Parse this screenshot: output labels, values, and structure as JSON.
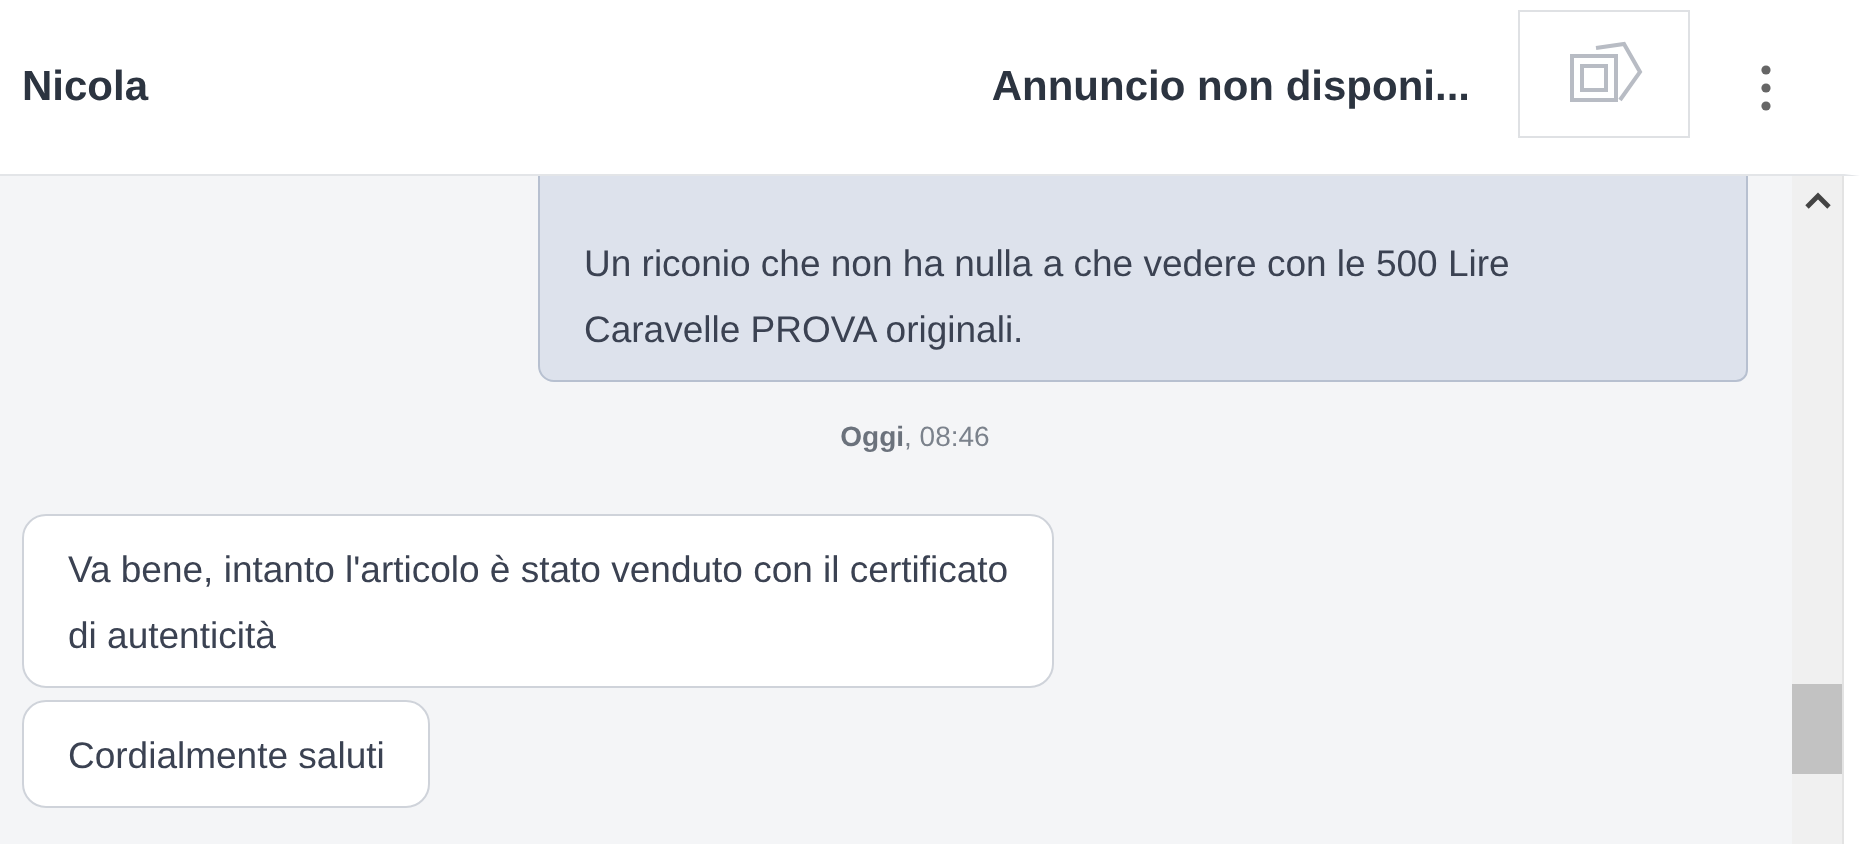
{
  "header": {
    "contact": "Nicola",
    "listing_title": "Annuncio non disponi..."
  },
  "messages": [
    {
      "kind": "sent",
      "lines": [
        "Un riconio che non ha nulla a che vedere con le 500 Lire",
        "Caravelle PROVA originali."
      ]
    },
    {
      "kind": "timestamp",
      "day": "Oggi",
      "time": ", 08:46"
    },
    {
      "kind": "received",
      "lines": [
        "Va bene, intanto l'articolo è stato venduto con il certificato",
        "di autenticità"
      ]
    },
    {
      "kind": "received",
      "lines": [
        "Cordialmente saluti"
      ]
    }
  ]
}
